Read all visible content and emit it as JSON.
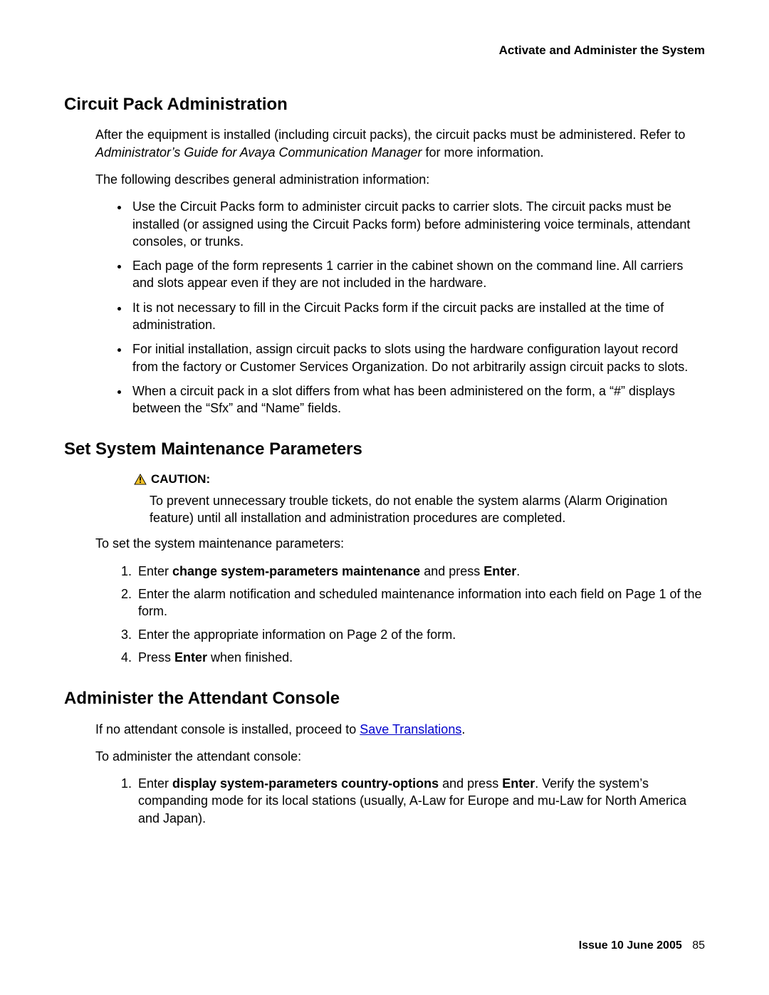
{
  "header": {
    "running_title": "Activate and Administer the System"
  },
  "sections": {
    "s1": {
      "title": "Circuit Pack Administration",
      "intro_pre": "After the equipment is installed (including circuit packs), the circuit packs must be administered. Refer to ",
      "intro_italic": "Administrator’s Guide for Avaya Communication Manager",
      "intro_post": " for more information.",
      "general_lead": "The following describes general administration information:",
      "bullets": [
        "Use the Circuit Packs form to administer circuit packs to carrier slots. The circuit packs must be installed (or assigned using the Circuit Packs form) before administering voice terminals, attendant consoles, or trunks.",
        "Each page of the form represents 1 carrier in the cabinet shown on the command line. All carriers and slots appear even if they are not included in the hardware.",
        "It is not necessary to fill in the Circuit Packs form if the circuit packs are installed at the time of administration.",
        "For initial installation, assign circuit packs to slots using the hardware configuration layout record from the factory or Customer Services Organization. Do not arbitrarily assign circuit packs to slots.",
        "When a circuit pack in a slot differs from what has been administered on the form, a “#” displays between the “Sfx” and “Name” fields."
      ]
    },
    "s2": {
      "title": "Set System Maintenance Parameters",
      "caution_label": "CAUTION:",
      "caution_text": "To prevent unnecessary trouble tickets, do not enable the system alarms (Alarm Origination feature) until all installation and administration procedures are completed.",
      "intro": "To set the system maintenance parameters:",
      "steps": {
        "s1_pre": "Enter ",
        "s1_cmd": "change system-parameters maintenance",
        "s1_mid": "  and press ",
        "s1_enter": "Enter",
        "s1_post": ".",
        "s2": "Enter the alarm notification and scheduled maintenance information into each field on Page 1 of the form.",
        "s3": "Enter the appropriate information on Page 2 of the form.",
        "s4_pre": "Press ",
        "s4_enter": "Enter",
        "s4_post": " when finished."
      }
    },
    "s3": {
      "title": "Administer the Attendant Console",
      "p1_pre": "If no attendant console is installed, proceed to ",
      "p1_link": "Save Translations",
      "p1_post": ".",
      "p2": "To administer the attendant console:",
      "steps": {
        "s1_pre": "Enter ",
        "s1_cmd": "display system-parameters country-options",
        "s1_mid": "  and press ",
        "s1_enter": "Enter",
        "s1_post": ". Verify the system’s companding mode for its local stations (usually, A-Law for Europe and mu-Law for North America and Japan)."
      }
    }
  },
  "footer": {
    "issue": "Issue 10   June 2005",
    "page": "85"
  }
}
